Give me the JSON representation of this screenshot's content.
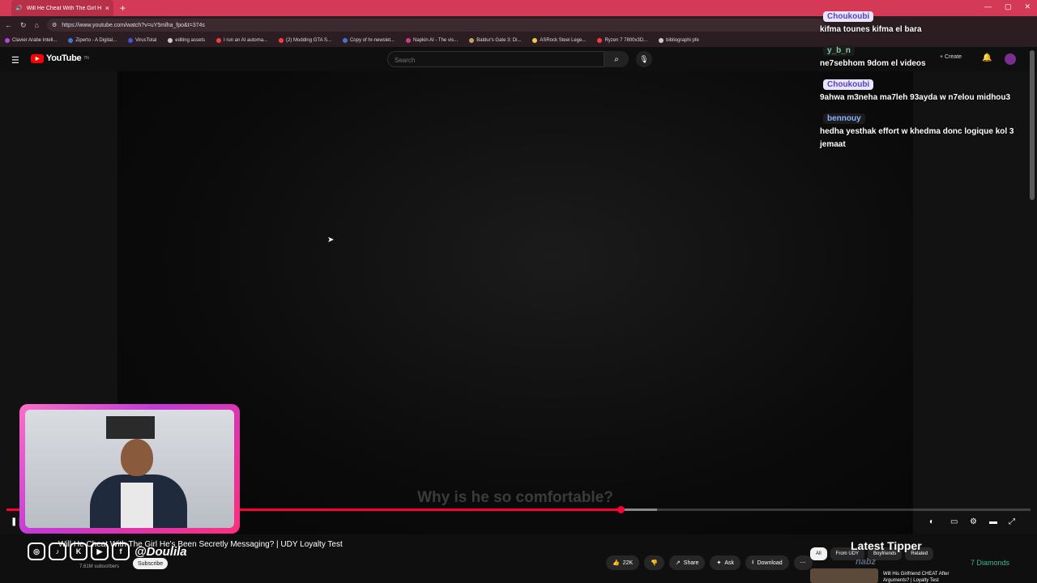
{
  "browser": {
    "tab_title": "Will He Cheat With The Girl He's",
    "tab_close": "×",
    "new_tab": "+",
    "url": "https://www.youtube.com/watch?v=uY5mlha_fpo&t=374s",
    "bookmarks": [
      {
        "label": "Clavier Arabe Intell...",
        "color": "#b04ad8"
      },
      {
        "label": "Ziperto - A Digital...",
        "color": "#3a7bd5"
      },
      {
        "label": "VirusTotal",
        "color": "#3a5bd5"
      },
      {
        "label": "editing assets",
        "color": "#cccccc"
      },
      {
        "label": "I run an AI automa...",
        "color": "#ff3b3b"
      },
      {
        "label": "(2) Modding GTA S...",
        "color": "#ff3b3b"
      },
      {
        "label": "Copy of hr-newslet...",
        "color": "#3a7bd5"
      },
      {
        "label": "Napkin AI - The vis...",
        "color": "#d13b8c"
      },
      {
        "label": "Baldur's Gate 3: Di...",
        "color": "#caa35a"
      },
      {
        "label": "ASRock Steel Lege...",
        "color": "#f2c94c"
      },
      {
        "label": "Ryzen 7 7800x3D...",
        "color": "#ff3b3b"
      },
      {
        "label": "bibliographi pfe",
        "color": "#cccccc"
      }
    ]
  },
  "youtube": {
    "logo_text": "YouTube",
    "logo_sup": "TN",
    "search_placeholder": "Search",
    "create_label": "+ Create"
  },
  "player": {
    "subtitle": "Why is he so comfortable?",
    "played_fraction": 0.6,
    "buffered_fraction": 0.635
  },
  "video": {
    "title": "Will He Cheat With The Girl He's Been Secretly Messaging? | UDY Loyalty Test",
    "subs": "7.61M subscribers",
    "subscribe": "Subscribe",
    "likes": "22K",
    "share": "Share",
    "ask": "Ask",
    "download": "Download"
  },
  "overlay": {
    "handle": "@Doulila",
    "latest_tipper": "Latest Tipper",
    "tipper_name": "nabz",
    "diamonds": "7 Diamonds"
  },
  "recommend": {
    "chips": [
      "All",
      "From UDY",
      "Boyfriends",
      "Related"
    ],
    "first_title": "Will His Girlfriend CHEAT After Arguments? | Loyalty Test"
  },
  "chat": [
    {
      "user": "Choukoubi",
      "style": "",
      "text": "kifma tounes kifma el bara"
    },
    {
      "user": "y_b_n",
      "style": "green",
      "text": "ne7sebhom 9dom el videos"
    },
    {
      "user": "Choukoubi",
      "style": "",
      "text": "9ahwa m3neha ma7leh 93ayda w n7elou midhou3"
    },
    {
      "user": "bennouy",
      "style": "blue",
      "text": "hedha yesthak effort w khedma donc logique kol 3 jemaat"
    }
  ]
}
